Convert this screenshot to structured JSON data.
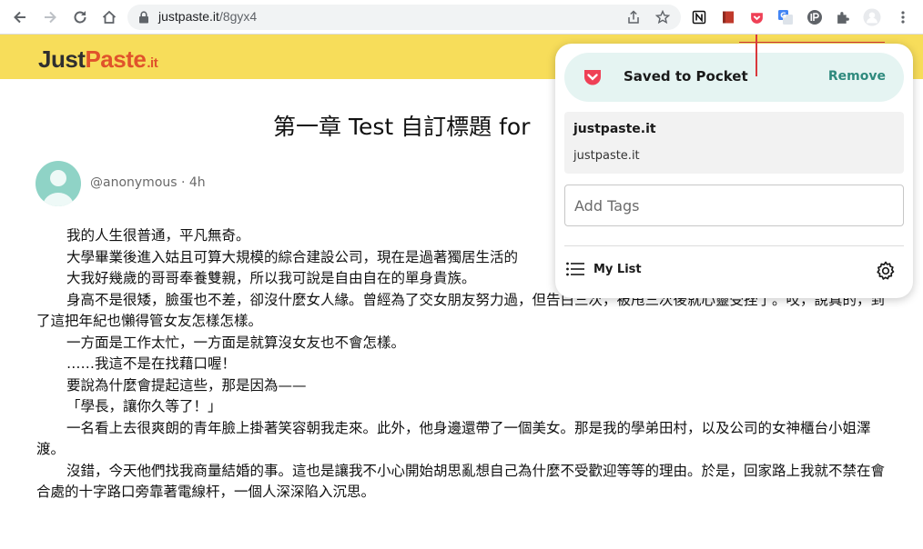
{
  "browser": {
    "url_host": "justpaste.it",
    "url_path": "/8gyx4"
  },
  "site": {
    "logo_just": "Just",
    "logo_paste": "Paste",
    "logo_it": ".it"
  },
  "article": {
    "title": "第一章 Test 自訂標題 for",
    "author": "@anonymous · 4h",
    "paragraphs": [
      "我的人生很普通，平凡無奇。",
      "大學畢業後進入姑且可算大規模的綜合建設公司，現在是過著獨居生活的",
      "大我好幾歲的哥哥奉養雙親，所以我可說是自由自在的單身貴族。",
      "身高不是很矮，臉蛋也不差，卻沒什麼女人緣。曾經為了交女朋友努力過，但告白三次，被甩三次後就心靈受挫了。哎，說真的，到了這把年紀也懶得管女友怎樣怎樣。",
      "一方面是工作太忙，一方面是就算沒女友也不會怎樣。",
      "……我這不是在找藉口喔！",
      "要說為什麼會提起這些，那是因為——",
      "「學長，讓你久等了！」",
      "一名看上去很爽朗的青年臉上掛著笑容朝我走來。此外，他身邊還帶了一個美女。那是我的學弟田村，以及公司的女神櫃台小姐澤渡。",
      "沒錯，今天他們找我商量結婚的事。這也是讓我不小心開始胡思亂想自己為什麼不受歡迎等等的理由。於是，回家路上我就不禁在會合處的十字路口旁靠著電線杆，一個人深深陷入沉思。"
    ]
  },
  "pocket": {
    "saved_label": "Saved to Pocket",
    "remove_label": "Remove",
    "site_name": "justpaste.it",
    "site_domain": "justpaste.it",
    "tags_placeholder": "Add Tags",
    "mylist_label": "My List",
    "accent": "#ef4056"
  }
}
